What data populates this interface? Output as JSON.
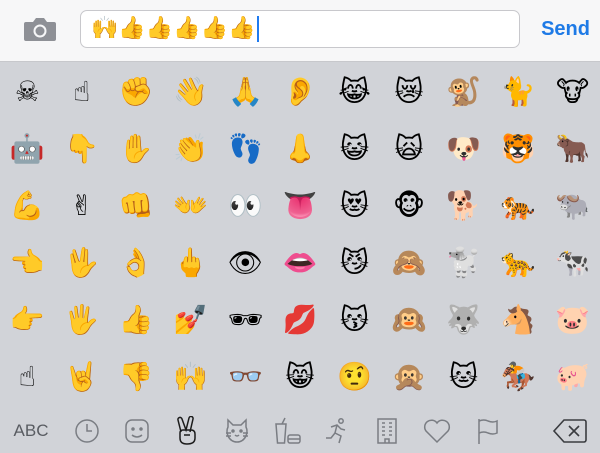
{
  "header": {
    "camera_icon": "camera-icon",
    "message_text": "🙌👍👍👍👍👍",
    "send_label": "Send"
  },
  "emoji_rows": [
    [
      "☠",
      "☝",
      "✊",
      "👋",
      "🙏",
      "👂",
      "😹",
      "😿",
      "🐒",
      "🐈",
      "🐮"
    ],
    [
      "🤖",
      "👇",
      "✋",
      "👏",
      "👣",
      "👃",
      "😺",
      "🙀",
      "🐶",
      "🐯",
      "🐂"
    ],
    [
      "💪",
      "✌",
      "👊",
      "👐",
      "👀",
      "👅",
      "😻",
      "🐵",
      "🐕",
      "🐅",
      "🐃"
    ],
    [
      "👈",
      "🖖",
      "👌",
      "🖕",
      "👁",
      "👄",
      "😼",
      "🙈",
      "🐩",
      "🐆",
      "🐄"
    ],
    [
      "👉",
      "🖐",
      "👍",
      "💅",
      "🕶",
      "💋",
      "😽",
      "🙉",
      "🐺",
      "🐴",
      "🐷"
    ],
    [
      "☝",
      "🤘",
      "👎",
      "🙌",
      "👓",
      "😸",
      "🤨",
      "🙊",
      "🐱",
      "🏇",
      "🐖"
    ]
  ],
  "footer": {
    "abc_label": "ABC",
    "categories": [
      {
        "name": "recent",
        "icon": "clock-icon"
      },
      {
        "name": "smileys",
        "icon": "smiley-icon"
      },
      {
        "name": "people",
        "icon": "victory-hand-icon",
        "active": true
      },
      {
        "name": "nature",
        "icon": "cat-icon"
      },
      {
        "name": "food",
        "icon": "cup-icon"
      },
      {
        "name": "activity",
        "icon": "runner-icon"
      },
      {
        "name": "places",
        "icon": "building-icon"
      },
      {
        "name": "symbols",
        "icon": "heart-icon"
      },
      {
        "name": "flags",
        "icon": "flag-icon"
      }
    ],
    "delete_icon": "backspace-icon"
  },
  "colors": {
    "accent": "#1e7ae6",
    "keyboard_bg": "#d1d3d8",
    "topbar_bg": "#f7f7f8"
  }
}
